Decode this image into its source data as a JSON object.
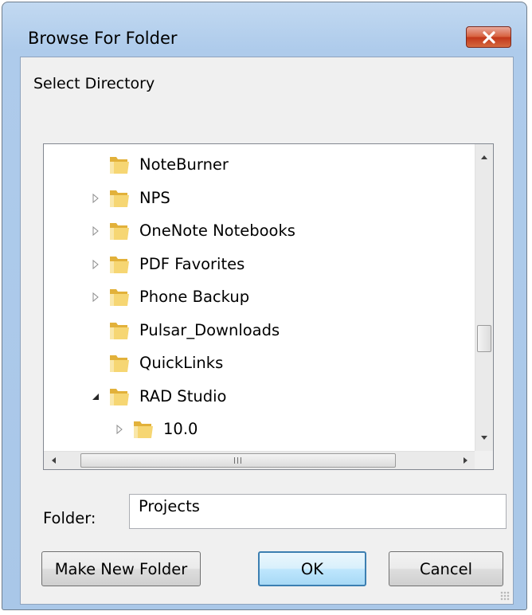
{
  "window": {
    "title": "Browse For Folder"
  },
  "instruction": "Select Directory",
  "tree": {
    "items": [
      {
        "label": "NoteBurner",
        "expander": "none",
        "indent": 1
      },
      {
        "label": "NPS",
        "expander": "collapsed",
        "indent": 1
      },
      {
        "label": "OneNote Notebooks",
        "expander": "collapsed",
        "indent": 1
      },
      {
        "label": "PDF Favorites",
        "expander": "collapsed",
        "indent": 1
      },
      {
        "label": "Phone Backup",
        "expander": "collapsed",
        "indent": 1
      },
      {
        "label": "Pulsar_Downloads",
        "expander": "none",
        "indent": 1
      },
      {
        "label": "QuickLinks",
        "expander": "none",
        "indent": 1
      },
      {
        "label": "RAD Studio",
        "expander": "expanded",
        "indent": 1
      },
      {
        "label": "10.0",
        "expander": "collapsed",
        "indent": 2
      }
    ],
    "hscroll_grip": "III"
  },
  "folder": {
    "label": "Folder:",
    "value": "Projects"
  },
  "buttons": {
    "make_new_folder": "Make New Folder",
    "ok": "OK",
    "cancel": "Cancel"
  },
  "icons": {
    "close": "close-icon",
    "folder": "folder-icon",
    "expander_collapsed": "triangle-right-icon",
    "expander_expanded": "triangle-down-right-icon"
  },
  "colors": {
    "title_bar": "#aecbeb",
    "close_button": "#c2371b",
    "default_button_border": "#3c7fb1",
    "folder_yellow": "#f0c64a"
  }
}
